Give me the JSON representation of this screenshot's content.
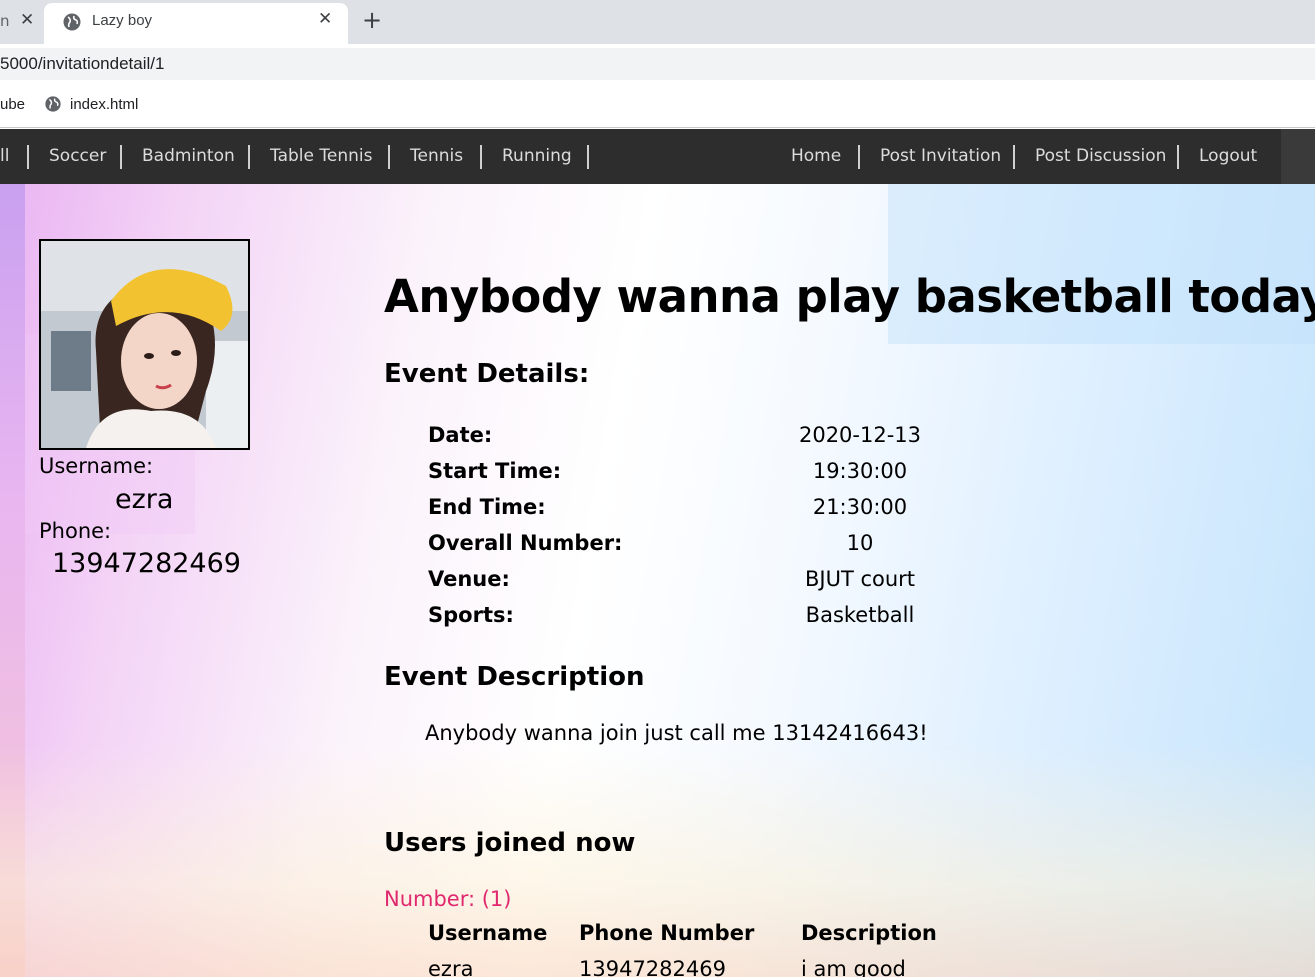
{
  "browser": {
    "prev_tab_fragment": "n",
    "prev_tab_close": "✕",
    "active_tab_title": "Lazy boy",
    "active_tab_close": "✕",
    "new_tab": "+",
    "url": "5000/invitationdetail/1",
    "bookmarks": [
      "ube",
      "index.html"
    ]
  },
  "nav": {
    "left_items": [
      "ll",
      "Soccer",
      "Badminton",
      "Table Tennis",
      "Tennis",
      "Running"
    ],
    "right_items": [
      "Home",
      "Post Invitation",
      "Post Discussion",
      "Logout"
    ]
  },
  "profile": {
    "username_label": "Username:",
    "username": "ezra",
    "phone_label": "Phone:",
    "phone": "13947282469"
  },
  "event": {
    "title": "Anybody wanna play basketball today?",
    "details_heading": "Event Details:",
    "details": [
      {
        "label": "Date:",
        "value": "2020-12-13"
      },
      {
        "label": "Start Time:",
        "value": "19:30:00"
      },
      {
        "label": "End Time:",
        "value": "21:30:00"
      },
      {
        "label": "Overall Number:",
        "value": "10"
      },
      {
        "label": "Venue:",
        "value": "BJUT court"
      },
      {
        "label": "Sports:",
        "value": "Basketball"
      }
    ],
    "description_heading": "Event Description",
    "description": "Anybody wanna join just call me 13142416643!"
  },
  "joined": {
    "heading": "Users joined now",
    "number_text": "Number: (1)",
    "columns": [
      "Username",
      "Phone Number",
      "Description"
    ],
    "rows": [
      [
        "ezra",
        "13947282469",
        "i am good"
      ]
    ]
  },
  "colors": {
    "navbar": "#2d2d2d",
    "number_accent": "#e0286e"
  }
}
